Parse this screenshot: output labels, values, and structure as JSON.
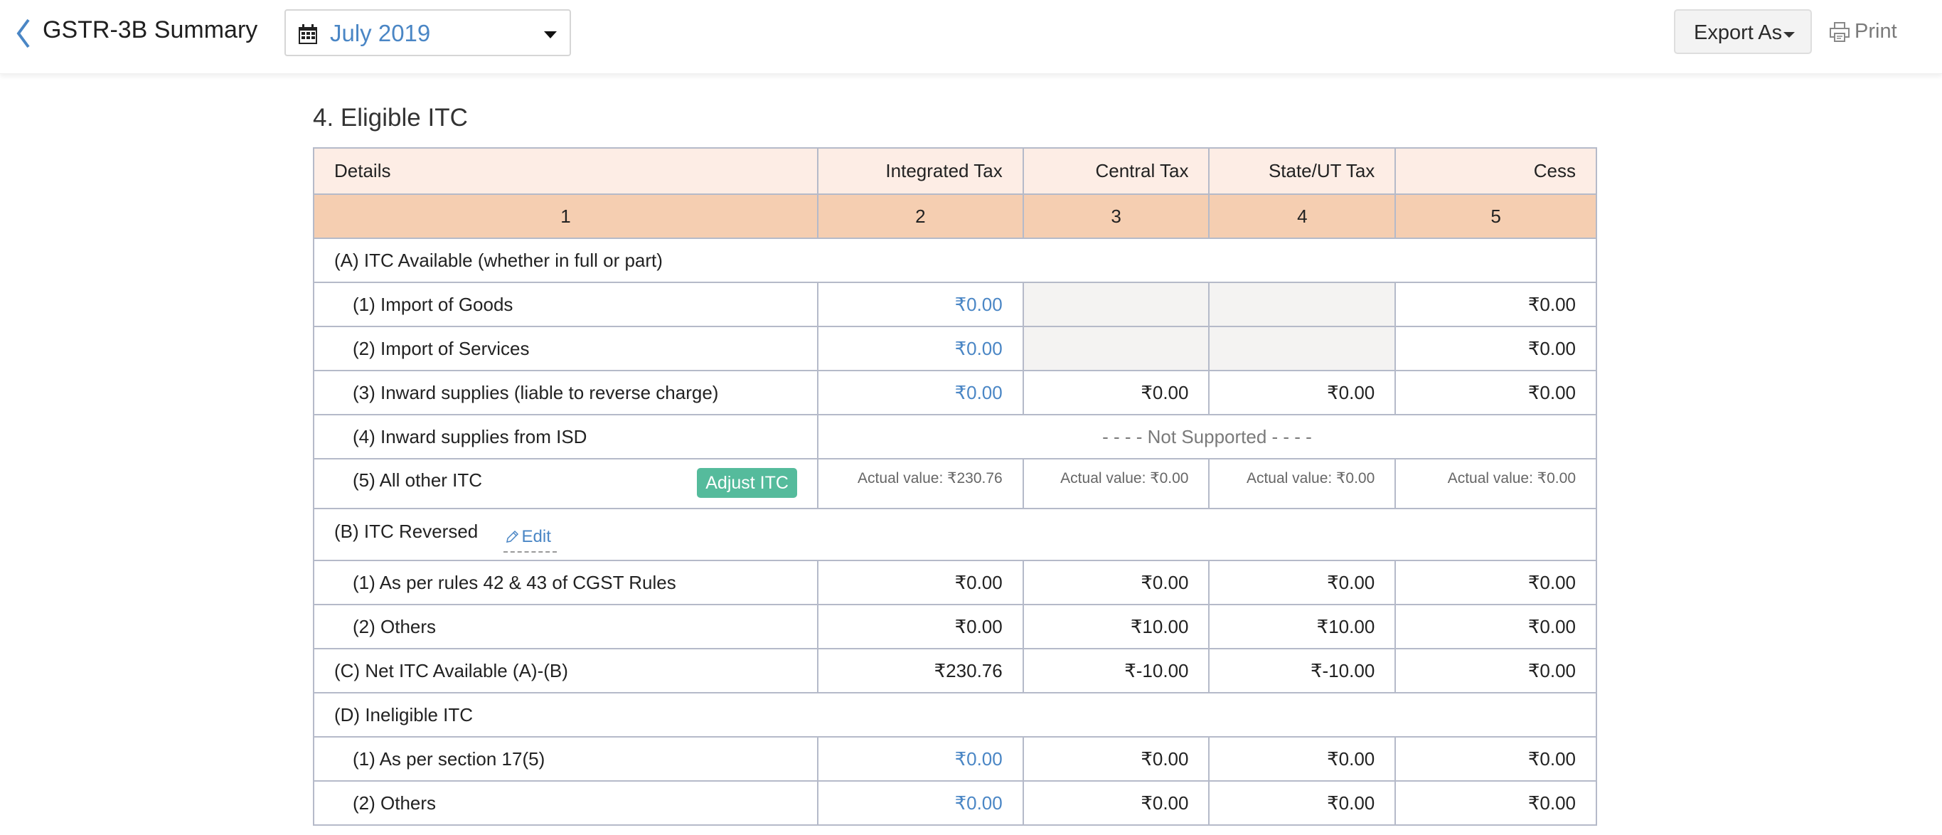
{
  "header": {
    "title": "GSTR-3B Summary",
    "period": "July 2019",
    "export_label": "Export As",
    "print_label": "Print",
    "icons": {
      "back": "chevron-left-icon",
      "calendar": "calendar-icon",
      "print": "printer-icon"
    },
    "accent_color": "#4a86c5"
  },
  "section": {
    "title": "4. Eligible ITC",
    "columns": [
      "Details",
      "Integrated Tax",
      "Central Tax",
      "State/UT Tax",
      "Cess"
    ],
    "column_numbers": [
      "1",
      "2",
      "3",
      "4",
      "5"
    ],
    "groups": {
      "A": {
        "label": "(A) ITC Available (whether in full or part)",
        "rows": [
          {
            "label": "(1) Import of Goods",
            "integrated": "₹0.00",
            "central": "",
            "state": "",
            "cess": "₹0.00"
          },
          {
            "label": "(2) Import of Services",
            "integrated": "₹0.00",
            "central": "",
            "state": "",
            "cess": "₹0.00"
          },
          {
            "label": "(3) Inward supplies (liable to reverse charge)",
            "integrated": "₹0.00",
            "central": "₹0.00",
            "state": "₹0.00",
            "cess": "₹0.00"
          },
          {
            "label": "(4) Inward supplies from ISD",
            "not_supported": "- - - - Not Supported - - - -"
          },
          {
            "label": "(5) All other ITC",
            "button": "Adjust ITC",
            "integrated": "Actual value: ₹230.76",
            "central": "Actual value: ₹0.00",
            "state": "Actual value: ₹0.00",
            "cess": "Actual value: ₹0.00"
          }
        ]
      },
      "B": {
        "label": "(B) ITC Reversed",
        "edit_label": "Edit",
        "rows": [
          {
            "label": "(1) As per rules 42 & 43 of CGST Rules",
            "integrated": "₹0.00",
            "central": "₹0.00",
            "state": "₹0.00",
            "cess": "₹0.00"
          },
          {
            "label": "(2) Others",
            "integrated": "₹0.00",
            "central": "₹10.00",
            "state": "₹10.00",
            "cess": "₹0.00"
          }
        ]
      },
      "C": {
        "label": "(C) Net ITC Available (A)-(B)",
        "integrated": "₹230.76",
        "central": "₹-10.00",
        "state": "₹-10.00",
        "cess": "₹0.00"
      },
      "D": {
        "label": "(D) Ineligible ITC",
        "rows": [
          {
            "label": "(1) As per section 17(5)",
            "integrated": "₹0.00",
            "central": "₹0.00",
            "state": "₹0.00",
            "cess": "₹0.00"
          },
          {
            "label": "(2) Others",
            "integrated": "₹0.00",
            "central": "₹0.00",
            "state": "₹0.00",
            "cess": "₹0.00"
          }
        ]
      }
    }
  }
}
